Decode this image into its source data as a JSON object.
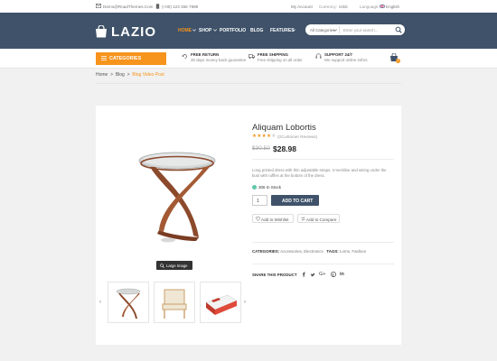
{
  "topbar": {
    "email": "Demo@RoadThemes.Com",
    "phone": "(+00) 123 456 7899",
    "account": "My Account",
    "currency": "USD",
    "currency_label": "Currency:",
    "language_label": "Language:",
    "language": "English"
  },
  "header": {
    "logo": "LAZIO",
    "nav": [
      "HOME",
      "SHOP",
      "PORTFOLIO",
      "BLOG",
      "FEATURES"
    ],
    "search_category": "All Categories",
    "search_placeholder": "Enter your search...",
    "cart_count": "0"
  },
  "features": {
    "categories_label": "CATEGORIES",
    "items": [
      {
        "title": "FREE RETURN",
        "subtitle": "30 days money back guarantee"
      },
      {
        "title": "FREE SHIPPING",
        "subtitle": "Free shipping on all order"
      },
      {
        "title": "SUPPORT 24/7",
        "subtitle": "We support online 24hrs"
      }
    ]
  },
  "breadcrumb": {
    "items": [
      "Home",
      "Blog"
    ],
    "current": "Blog Video Post",
    "separator": ">"
  },
  "product": {
    "title": "Aliquam Lobortis",
    "rating": 4,
    "reviews": "(2Customer Reviews)",
    "old_price": "$30.50",
    "price": "$28.98",
    "description": "Long printed dress with thin adjustable straps. V-neckline and wiring under the bust with ruffles at the bottom of the dress.",
    "stock": "306 In Stock",
    "quantity": "1",
    "add_to_cart": "ADD TO CART",
    "wishlist": "Add to Wishlist",
    "compare": "Add to Compare",
    "large_image": "Large Image",
    "categories_label": "CATEGORIES:",
    "categories": "Accessories, Electronics",
    "tags_label": "TAGS:",
    "tags": "Lorns, Fashion",
    "share_label": "SHARE THIS PRODUCT"
  },
  "icons": {
    "accent": "#f7941d",
    "header_bg": "#3f5269",
    "in_stock": "#5ec8a8"
  }
}
